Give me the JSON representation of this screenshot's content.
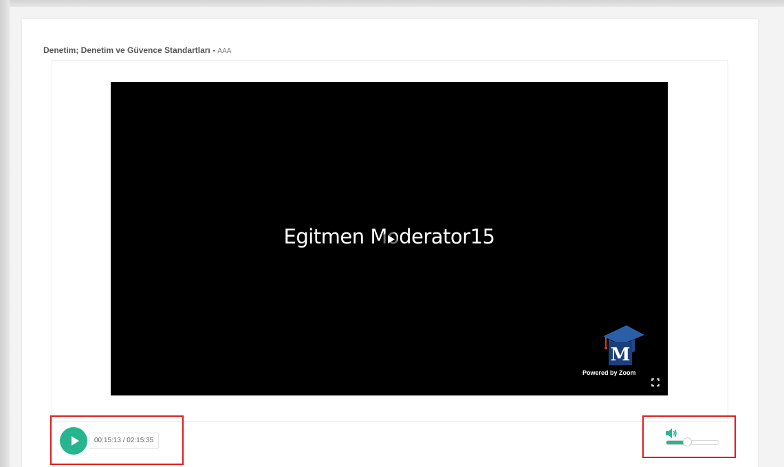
{
  "page": {
    "title": "Denetim; Denetim ve Güvence Standartları - ",
    "subtitle": "AAA"
  },
  "video": {
    "caption": "Egitmen Moderator15",
    "powered_by": "Powered by Zoom",
    "center_icon": "play-icon",
    "logo_icon": "graduation-cap-logo",
    "fullscreen_icon": "fullscreen-icon"
  },
  "controls": {
    "play_icon": "play-icon",
    "time_display": "00:15:13 / 02:15:35",
    "volume_icon": "volume-icon",
    "volume_level": 0.4
  },
  "colors": {
    "accent": "#26b58f",
    "highlight": "#e21b1b",
    "video_bg": "#000000"
  }
}
